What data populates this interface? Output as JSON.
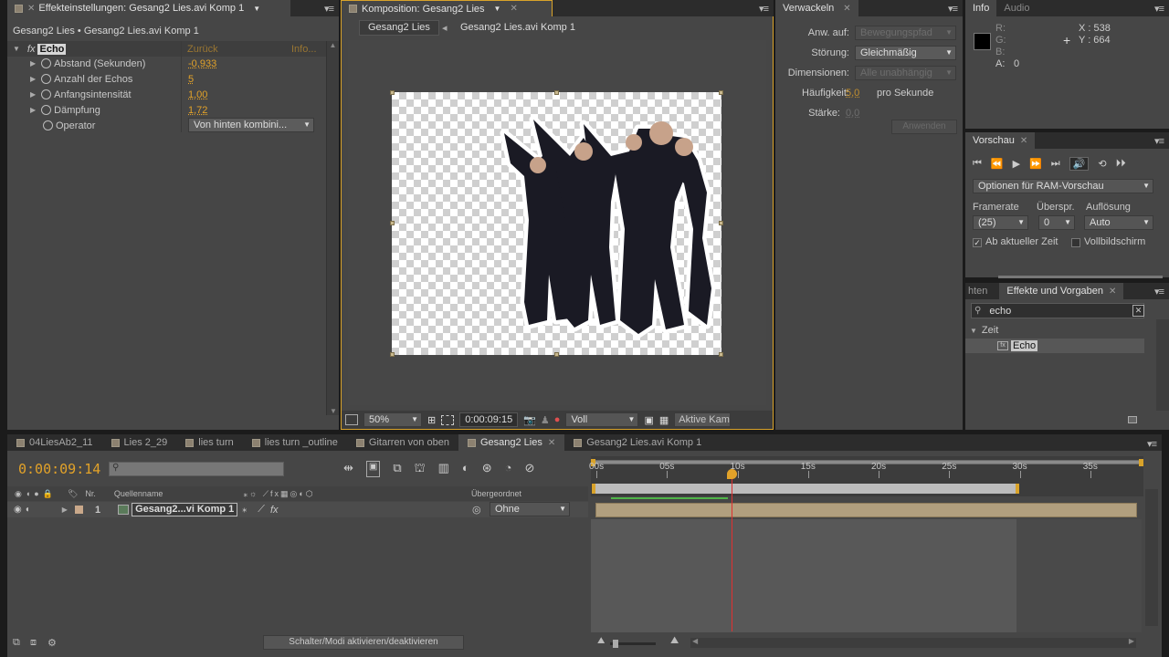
{
  "effect_controls": {
    "tab_title": "Effekteinstellungen: Gesang2 Lies.avi Komp 1",
    "breadcrumb": "Gesang2 Lies • Gesang2 Lies.avi Komp 1",
    "effect_name": "Echo",
    "fx": "fx",
    "reset": "Zurück",
    "about": "Info...",
    "params": [
      {
        "label": "Abstand (Sekunden)",
        "value": "-0,933"
      },
      {
        "label": "Anzahl der Echos",
        "value": "5"
      },
      {
        "label": "Anfangsintensität",
        "value": "1,00"
      },
      {
        "label": "Dämpfung",
        "value": "1,72"
      }
    ],
    "operator_label": "Operator",
    "operator_value": "Von hinten kombini..."
  },
  "composition": {
    "tab_title": "Komposition: Gesang2 Lies",
    "nav_active": "Gesang2 Lies",
    "nav_arrow": "◂",
    "nav_next": "Gesang2 Lies.avi Komp 1",
    "zoom": "50%",
    "timecode": "0:00:09:15",
    "resolution": "Voll",
    "camera": "Aktive Kam"
  },
  "wiggler": {
    "tab_title": "Verwackeln",
    "apply_to_label": "Anw. auf:",
    "apply_to_value": "Bewegungspfad",
    "noise_label": "Störung:",
    "noise_value": "Gleichmäßig",
    "dimensions_label": "Dimensionen:",
    "dimensions_value": "Alle unabhängig",
    "frequency_label": "Häufigkeit:",
    "frequency_value": "5,0",
    "frequency_unit": "pro Sekunde",
    "magnitude_label": "Stärke:",
    "magnitude_value": "0,0",
    "apply_button": "Anwenden"
  },
  "info": {
    "tab_info": "Info",
    "tab_audio": "Audio",
    "r": "R:",
    "g": "G:",
    "b": "B:",
    "a": "A:",
    "a_value": "0",
    "x": "X : 538",
    "y": "Y : 664"
  },
  "preview": {
    "tab_title": "Vorschau",
    "ram_options": "Optionen für RAM-Vorschau",
    "framerate_label": "Framerate",
    "skip_label": "Überspr.",
    "resolution_label": "Auflösung",
    "framerate_value": "(25)",
    "skip_value": "0",
    "resolution_value": "Auto",
    "from_current": "Ab aktueller Zeit",
    "fullscreen": "Vollbildschirm"
  },
  "effects_presets": {
    "tab_prev": "hten",
    "tab_title": "Effekte und Vorgaben",
    "search_value": "echo",
    "category": "Zeit",
    "item": "Echo"
  },
  "timeline": {
    "tabs": [
      {
        "label": "04LiesAb2_11",
        "active": false
      },
      {
        "label": "Lies 2_29",
        "active": false
      },
      {
        "label": "lies turn",
        "active": false
      },
      {
        "label": "lies turn _outline",
        "active": false
      },
      {
        "label": "Gitarren von oben",
        "active": false
      },
      {
        "label": "Gesang2 Lies",
        "active": true
      },
      {
        "label": "Gesang2 Lies.avi Komp 1",
        "active": false
      }
    ],
    "current_time": "0:00:09:14",
    "col_nr": "Nr.",
    "col_source": "Quellenname",
    "col_parent": "Übergeordnet",
    "layer_index": "1",
    "layer_name": "Gesang2...vi Komp 1",
    "layer_parent": "Ohne",
    "ruler_labels": [
      "00s",
      "05s",
      "10s",
      "15s",
      "20s",
      "25s",
      "30s",
      "35s"
    ],
    "playhead_seconds": 9.56,
    "bottom_button": "Schalter/Modi aktivieren/deaktivieren"
  }
}
